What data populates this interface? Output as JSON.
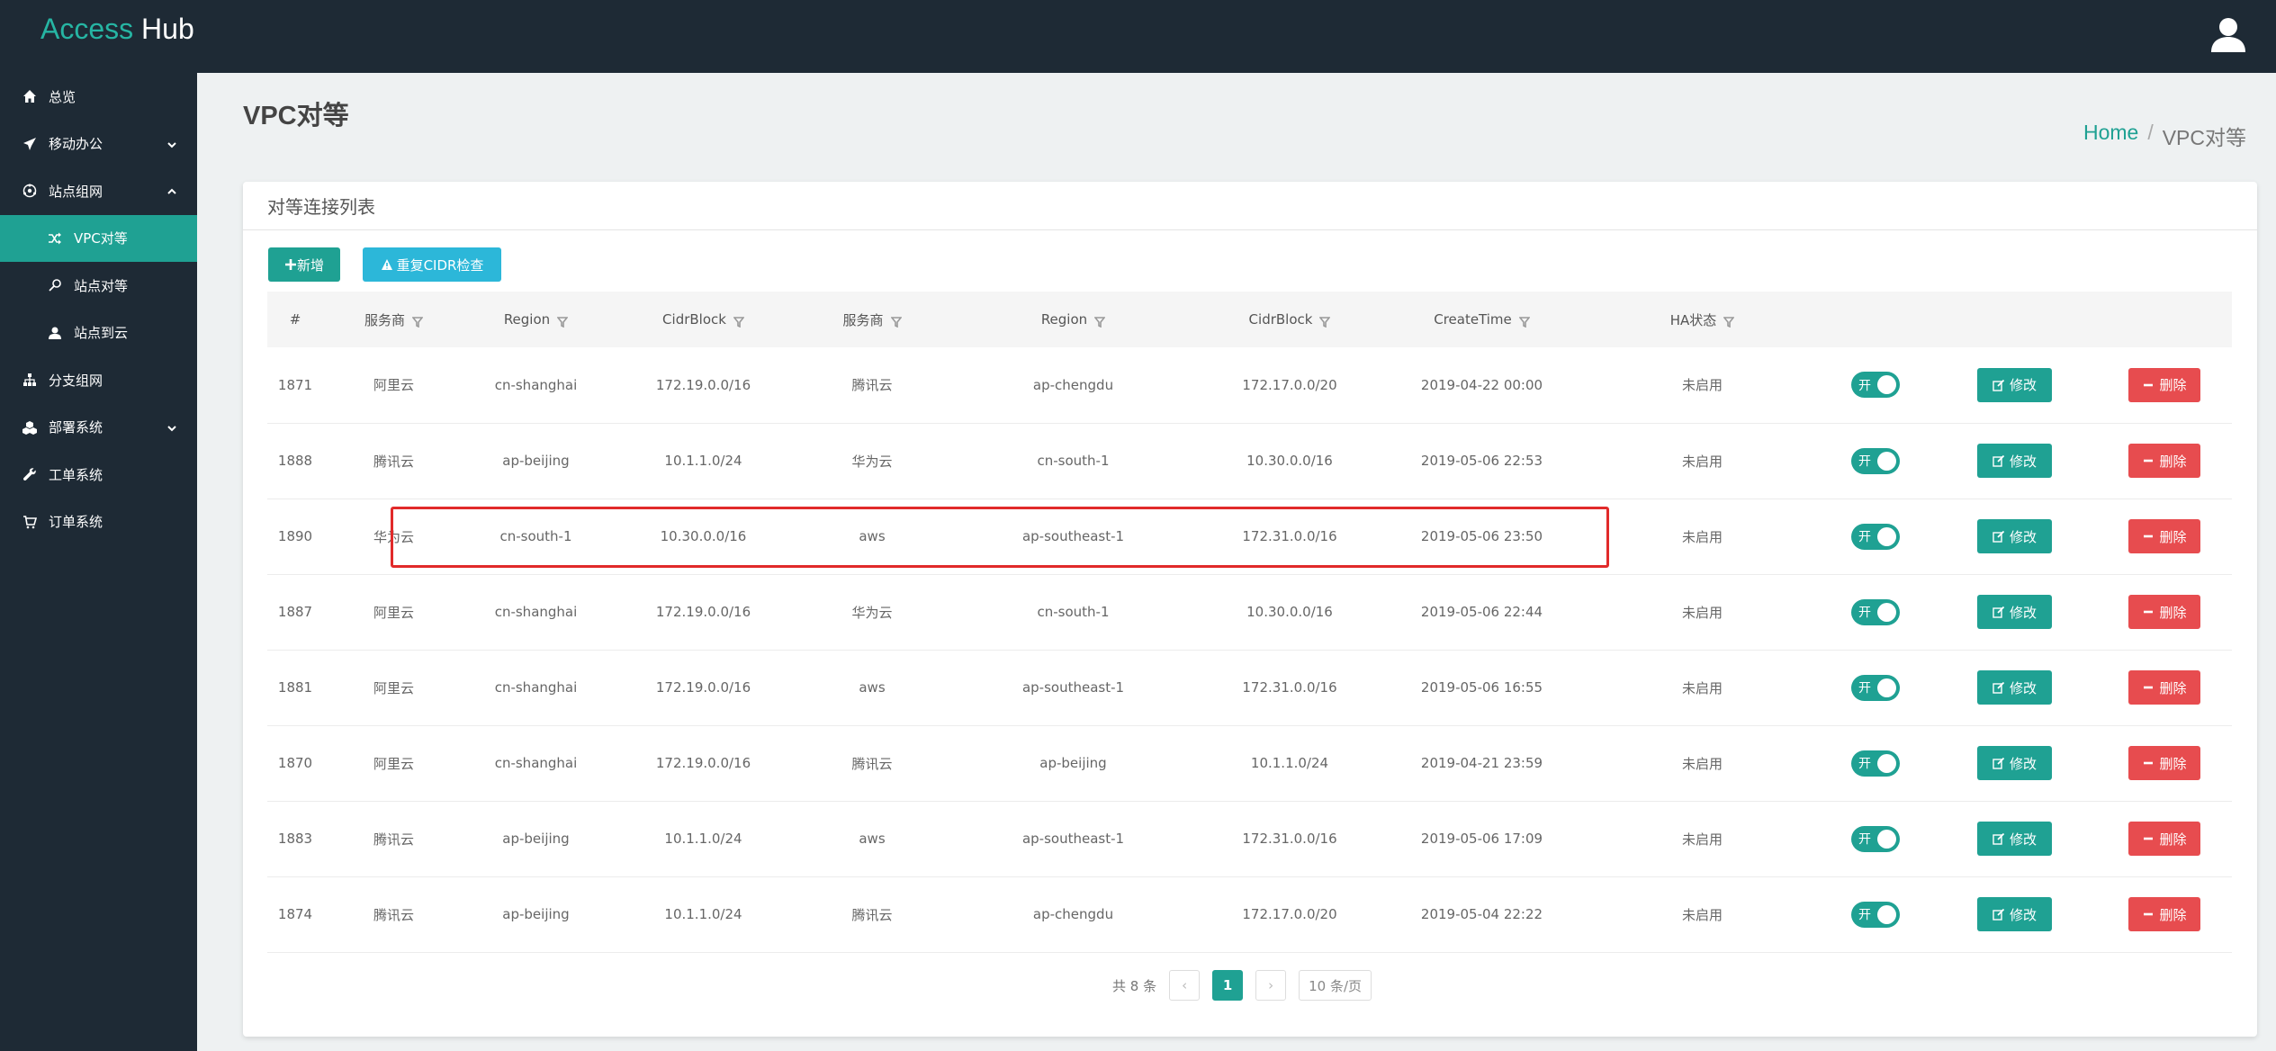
{
  "app": {
    "brand_part1": "Access",
    "brand_part2": "Hub"
  },
  "sidebar": {
    "items": [
      {
        "label": "总览",
        "icon": "home-icon"
      },
      {
        "label": "移动办公",
        "icon": "plane-icon",
        "chevron": "down"
      },
      {
        "label": "站点组网",
        "icon": "network-icon",
        "chevron": "up"
      },
      {
        "label": "VPC对等",
        "icon": "shuffle-icon",
        "active": true
      },
      {
        "label": "站点对等",
        "icon": "tag-icon"
      },
      {
        "label": "站点到云",
        "icon": "upload-icon"
      },
      {
        "label": "分支组网",
        "icon": "sitemap-icon"
      },
      {
        "label": "部署系统",
        "icon": "cubes-icon",
        "chevron": "down"
      },
      {
        "label": "工单系统",
        "icon": "wrench-icon"
      },
      {
        "label": "订单系统",
        "icon": "cart-icon"
      }
    ]
  },
  "page": {
    "title": "VPC对等"
  },
  "breadcrumb": {
    "home": "Home",
    "sep": "/",
    "current": "VPC对等"
  },
  "card": {
    "title": "对等连接列表"
  },
  "toolbar": {
    "add_label": "新增",
    "check_label": "重复CIDR检查"
  },
  "table": {
    "headers": [
      "#",
      "服务商",
      "Region",
      "CidrBlock",
      "服务商",
      "Region",
      "CidrBlock",
      "CreateTime",
      "HA状态"
    ],
    "toggle_label": "开",
    "edit_label": "修改",
    "delete_label": "删除",
    "rows": [
      [
        "1871",
        "阿里云",
        "cn-shanghai",
        "172.19.0.0/16",
        "腾讯云",
        "ap-chengdu",
        "172.17.0.0/20",
        "2019-04-22 00:00",
        "未启用"
      ],
      [
        "1888",
        "腾讯云",
        "ap-beijing",
        "10.1.1.0/24",
        "华为云",
        "cn-south-1",
        "10.30.0.0/16",
        "2019-05-06 22:53",
        "未启用"
      ],
      [
        "1890",
        "华为云",
        "cn-south-1",
        "10.30.0.0/16",
        "aws",
        "ap-southeast-1",
        "172.31.0.0/16",
        "2019-05-06 23:50",
        "未启用"
      ],
      [
        "1887",
        "阿里云",
        "cn-shanghai",
        "172.19.0.0/16",
        "华为云",
        "cn-south-1",
        "10.30.0.0/16",
        "2019-05-06 22:44",
        "未启用"
      ],
      [
        "1881",
        "阿里云",
        "cn-shanghai",
        "172.19.0.0/16",
        "aws",
        "ap-southeast-1",
        "172.31.0.0/16",
        "2019-05-06 16:55",
        "未启用"
      ],
      [
        "1870",
        "阿里云",
        "cn-shanghai",
        "172.19.0.0/16",
        "腾讯云",
        "ap-beijing",
        "10.1.1.0/24",
        "2019-04-21 23:59",
        "未启用"
      ],
      [
        "1883",
        "腾讯云",
        "ap-beijing",
        "10.1.1.0/24",
        "aws",
        "ap-southeast-1",
        "172.31.0.0/16",
        "2019-05-06 17:09",
        "未启用"
      ],
      [
        "1874",
        "腾讯云",
        "ap-beijing",
        "10.1.1.0/24",
        "腾讯云",
        "ap-chengdu",
        "172.17.0.0/20",
        "2019-05-04 22:22",
        "未启用"
      ]
    ]
  },
  "pagination": {
    "total": "共 8 条",
    "prev": "‹",
    "current": "1",
    "next": "›",
    "page_size": "10 条/页"
  },
  "colors": {
    "accent": "#1fa193",
    "danger": "#e74c4f",
    "info": "#2cb7d9",
    "nav_bg": "#1e2a35",
    "highlight": "#e12a2a"
  }
}
